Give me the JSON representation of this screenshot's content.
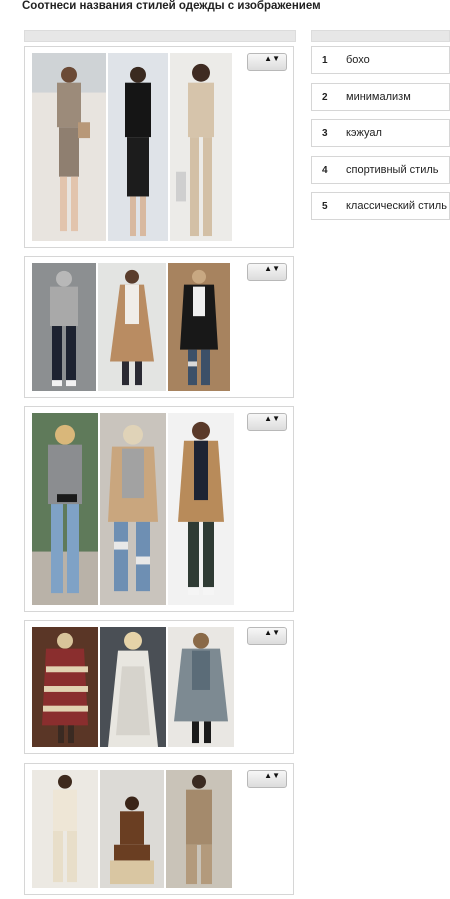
{
  "title": "Соотнеси названия стилей одежды с изображением",
  "items": [
    {
      "photos": [
        "photo-business-woman-beige-suit",
        "photo-woman-black-suit",
        "photo-woman-beige-pantsuit"
      ]
    },
    {
      "photos": [
        "photo-woman-grey-hoodie",
        "photo-woman-camel-coat",
        "photo-woman-black-coat-ripped-jeans"
      ]
    },
    {
      "photos": [
        "photo-woman-grey-sweater-jeans",
        "photo-woman-sweater-ripped-jeans",
        "photo-woman-trench-coat"
      ]
    },
    {
      "photos": [
        "photo-woman-patterned-knit-cardigan",
        "photo-woman-white-lace-dress",
        "photo-woman-grey-fringe-cardigan"
      ]
    },
    {
      "photos": [
        "photo-woman-cream-knit-set",
        "photo-woman-brown-knit-sitting",
        "photo-woman-beige-knit-dress"
      ]
    }
  ],
  "options": [
    {
      "num": "1",
      "label": "бохо"
    },
    {
      "num": "2",
      "label": "минимализм"
    },
    {
      "num": "3",
      "label": "кэжуал"
    },
    {
      "num": "4",
      "label": "спортивный стиль"
    },
    {
      "num": "5",
      "label": "классический стиль"
    }
  ],
  "select_arrow": "▲▼",
  "colors": {
    "header_bar": "#e7e7e7",
    "border": "#d6d6d6"
  }
}
